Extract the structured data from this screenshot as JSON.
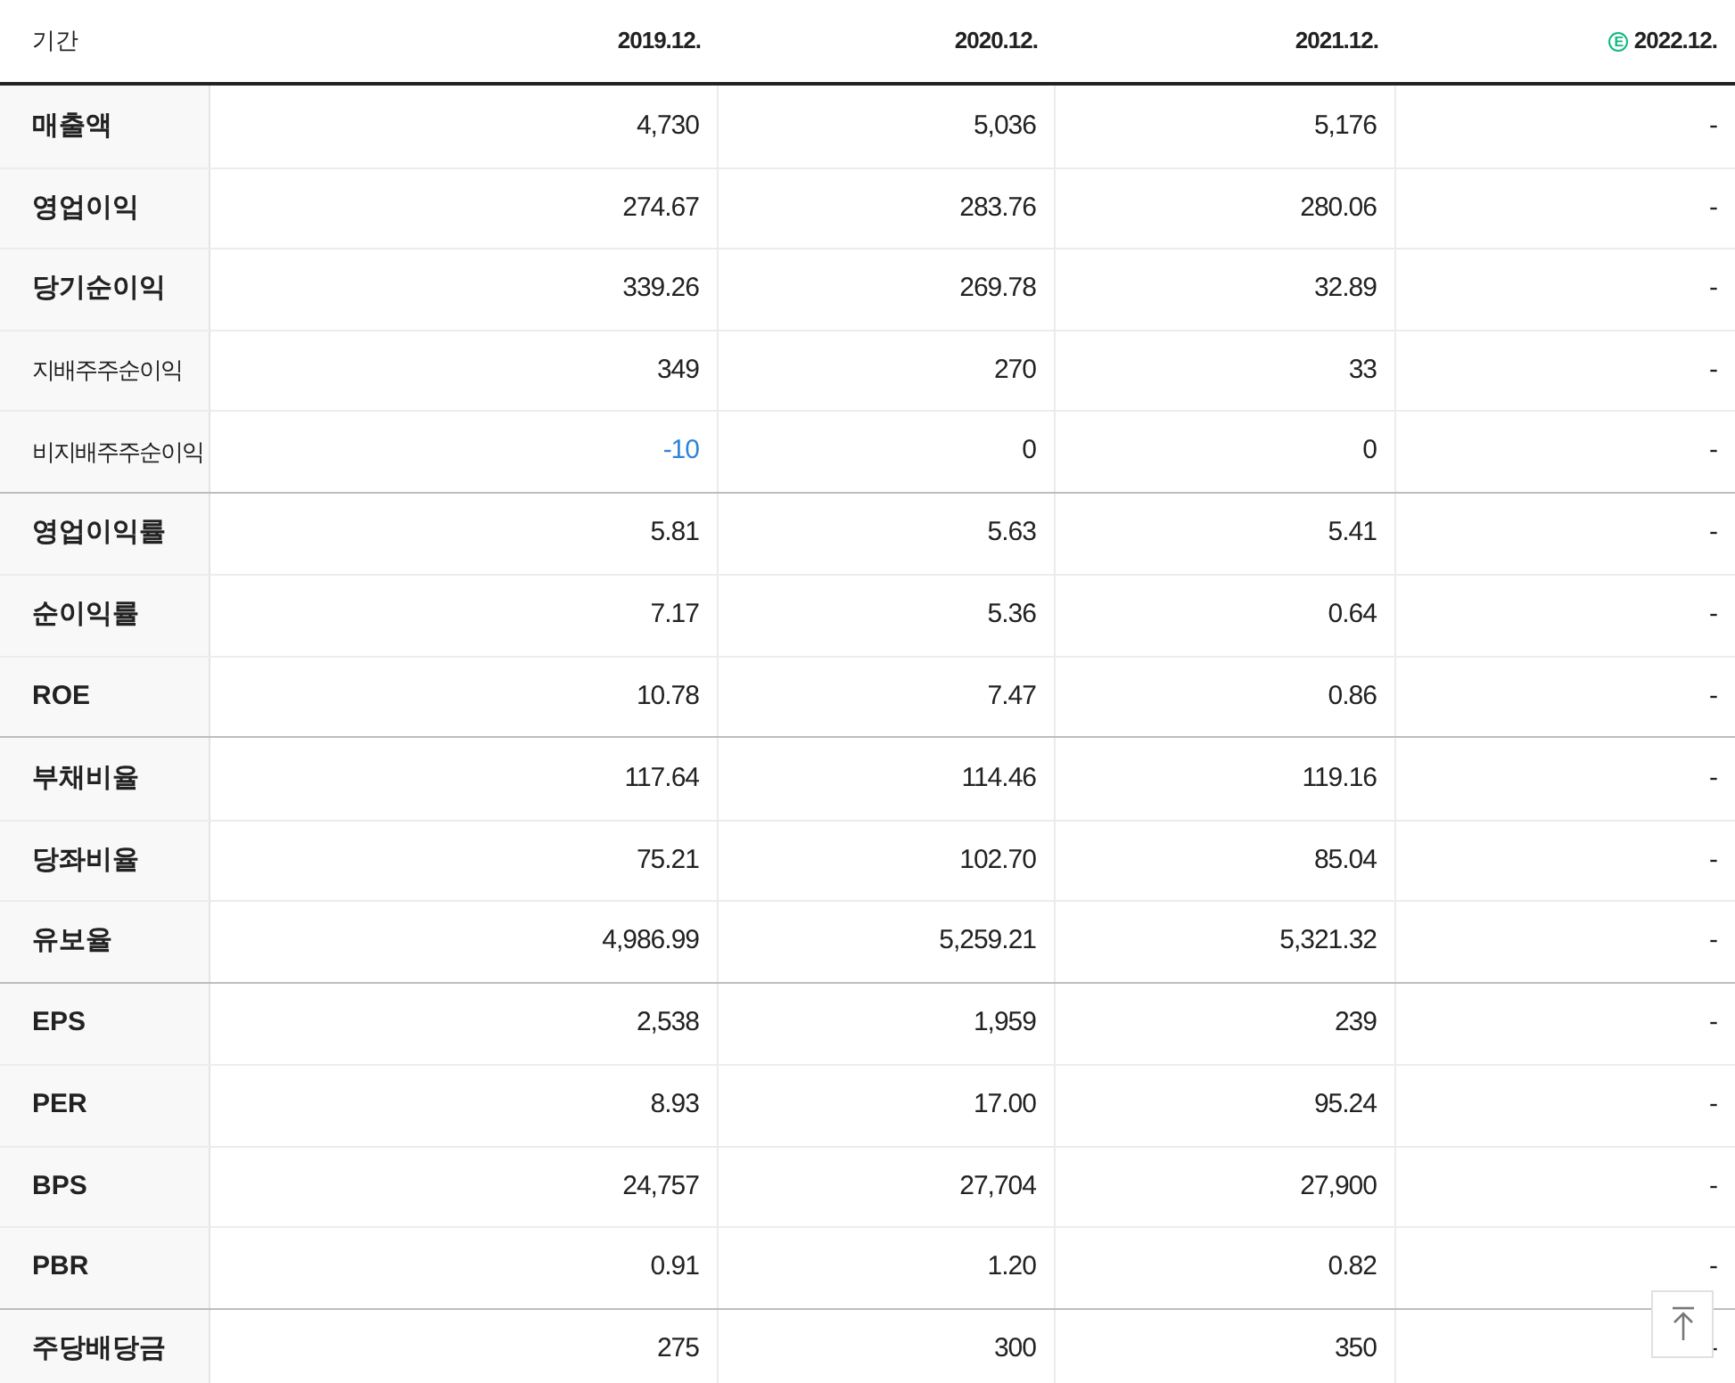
{
  "header": {
    "label": "기간",
    "columns": [
      {
        "label": "2019.12.",
        "estimate": false
      },
      {
        "label": "2020.12.",
        "estimate": false
      },
      {
        "label": "2021.12.",
        "estimate": false
      },
      {
        "label": "2022.12.",
        "estimate": true
      }
    ]
  },
  "estimate_mark": "E",
  "groups": [
    {
      "rows": [
        {
          "label": "매출액",
          "kind": "main",
          "cells": [
            {
              "text": "4,730",
              "negative": false
            },
            {
              "text": "5,036",
              "negative": false
            },
            {
              "text": "5,176",
              "negative": false
            },
            {
              "text": "-",
              "negative": false
            }
          ]
        },
        {
          "label": "영업이익",
          "kind": "main",
          "cells": [
            {
              "text": "274.67",
              "negative": false
            },
            {
              "text": "283.76",
              "negative": false
            },
            {
              "text": "280.06",
              "negative": false
            },
            {
              "text": "-",
              "negative": false
            }
          ]
        },
        {
          "label": "당기순이익",
          "kind": "main",
          "cells": [
            {
              "text": "339.26",
              "negative": false
            },
            {
              "text": "269.78",
              "negative": false
            },
            {
              "text": "32.89",
              "negative": false
            },
            {
              "text": "-",
              "negative": false
            }
          ]
        },
        {
          "label": "지배주주순이익",
          "kind": "sub",
          "cells": [
            {
              "text": "349",
              "negative": false
            },
            {
              "text": "270",
              "negative": false
            },
            {
              "text": "33",
              "negative": false
            },
            {
              "text": "-",
              "negative": false
            }
          ]
        },
        {
          "label": "비지배주주순이익",
          "kind": "sub",
          "cells": [
            {
              "text": "-10",
              "negative": true
            },
            {
              "text": "0",
              "negative": false
            },
            {
              "text": "0",
              "negative": false
            },
            {
              "text": "-",
              "negative": false
            }
          ]
        }
      ]
    },
    {
      "rows": [
        {
          "label": "영업이익률",
          "kind": "main",
          "cells": [
            {
              "text": "5.81",
              "negative": false
            },
            {
              "text": "5.63",
              "negative": false
            },
            {
              "text": "5.41",
              "negative": false
            },
            {
              "text": "-",
              "negative": false
            }
          ]
        },
        {
          "label": "순이익률",
          "kind": "main",
          "cells": [
            {
              "text": "7.17",
              "negative": false
            },
            {
              "text": "5.36",
              "negative": false
            },
            {
              "text": "0.64",
              "negative": false
            },
            {
              "text": "-",
              "negative": false
            }
          ]
        },
        {
          "label": "ROE",
          "kind": "main",
          "cells": [
            {
              "text": "10.78",
              "negative": false
            },
            {
              "text": "7.47",
              "negative": false
            },
            {
              "text": "0.86",
              "negative": false
            },
            {
              "text": "-",
              "negative": false
            }
          ]
        }
      ]
    },
    {
      "rows": [
        {
          "label": "부채비율",
          "kind": "main",
          "cells": [
            {
              "text": "117.64",
              "negative": false
            },
            {
              "text": "114.46",
              "negative": false
            },
            {
              "text": "119.16",
              "negative": false
            },
            {
              "text": "-",
              "negative": false
            }
          ]
        },
        {
          "label": "당좌비율",
          "kind": "main",
          "cells": [
            {
              "text": "75.21",
              "negative": false
            },
            {
              "text": "102.70",
              "negative": false
            },
            {
              "text": "85.04",
              "negative": false
            },
            {
              "text": "-",
              "negative": false
            }
          ]
        },
        {
          "label": "유보율",
          "kind": "main",
          "cells": [
            {
              "text": "4,986.99",
              "negative": false
            },
            {
              "text": "5,259.21",
              "negative": false
            },
            {
              "text": "5,321.32",
              "negative": false
            },
            {
              "text": "-",
              "negative": false
            }
          ]
        }
      ]
    },
    {
      "rows": [
        {
          "label": "EPS",
          "kind": "main",
          "cells": [
            {
              "text": "2,538",
              "negative": false
            },
            {
              "text": "1,959",
              "negative": false
            },
            {
              "text": "239",
              "negative": false
            },
            {
              "text": "-",
              "negative": false
            }
          ]
        },
        {
          "label": "PER",
          "kind": "main",
          "cells": [
            {
              "text": "8.93",
              "negative": false
            },
            {
              "text": "17.00",
              "negative": false
            },
            {
              "text": "95.24",
              "negative": false
            },
            {
              "text": "-",
              "negative": false
            }
          ]
        },
        {
          "label": "BPS",
          "kind": "main",
          "cells": [
            {
              "text": "24,757",
              "negative": false
            },
            {
              "text": "27,704",
              "negative": false
            },
            {
              "text": "27,900",
              "negative": false
            },
            {
              "text": "-",
              "negative": false
            }
          ]
        },
        {
          "label": "PBR",
          "kind": "main",
          "cells": [
            {
              "text": "0.91",
              "negative": false
            },
            {
              "text": "1.20",
              "negative": false
            },
            {
              "text": "0.82",
              "negative": false
            },
            {
              "text": "-",
              "negative": false
            }
          ]
        }
      ]
    },
    {
      "rows": [
        {
          "label": "주당배당금",
          "kind": "main",
          "cells": [
            {
              "text": "275",
              "negative": false
            },
            {
              "text": "300",
              "negative": false
            },
            {
              "text": "350",
              "negative": false
            },
            {
              "text": "-",
              "negative": false
            }
          ]
        }
      ]
    }
  ]
}
